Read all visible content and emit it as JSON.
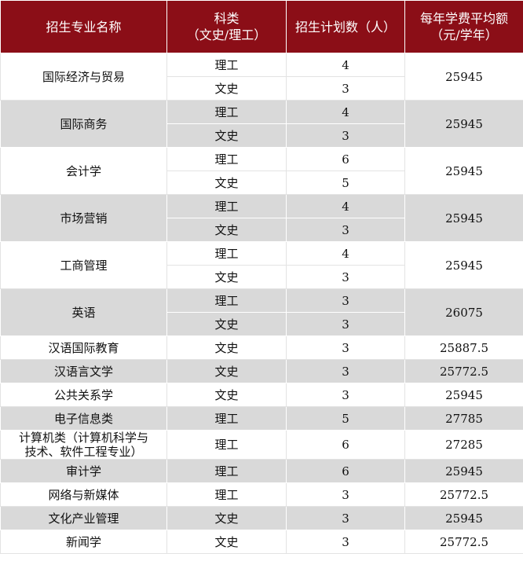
{
  "header": {
    "col_major": "招生专业名称",
    "col_category_line1": "科类",
    "col_category_line2": "（文史/理工）",
    "col_plan": "招生计划数（人）",
    "col_fee_line1": "每年学费平均额",
    "col_fee_line2": "（元/学年）"
  },
  "rows": [
    {
      "major": "国际经济与贸易",
      "fee": "25945",
      "tracks": [
        {
          "category": "理工",
          "count": "4"
        },
        {
          "category": "文史",
          "count": "3"
        }
      ]
    },
    {
      "major": "国际商务",
      "fee": "25945",
      "tracks": [
        {
          "category": "理工",
          "count": "4"
        },
        {
          "category": "文史",
          "count": "3"
        }
      ]
    },
    {
      "major": "会计学",
      "fee": "25945",
      "tracks": [
        {
          "category": "理工",
          "count": "6"
        },
        {
          "category": "文史",
          "count": "5"
        }
      ]
    },
    {
      "major": "市场营销",
      "fee": "25945",
      "tracks": [
        {
          "category": "理工",
          "count": "4"
        },
        {
          "category": "文史",
          "count": "3"
        }
      ]
    },
    {
      "major": "工商管理",
      "fee": "25945",
      "tracks": [
        {
          "category": "理工",
          "count": "4"
        },
        {
          "category": "文史",
          "count": "3"
        }
      ]
    },
    {
      "major": "英语",
      "fee": "26075",
      "tracks": [
        {
          "category": "理工",
          "count": "3"
        },
        {
          "category": "文史",
          "count": "3"
        }
      ]
    },
    {
      "major": "汉语国际教育",
      "fee": "25887.5",
      "tracks": [
        {
          "category": "文史",
          "count": "3"
        }
      ]
    },
    {
      "major": "汉语言文学",
      "fee": "25772.5",
      "tracks": [
        {
          "category": "文史",
          "count": "3"
        }
      ]
    },
    {
      "major": "公共关系学",
      "fee": "25945",
      "tracks": [
        {
          "category": "文史",
          "count": "3"
        }
      ]
    },
    {
      "major": "电子信息类",
      "fee": "27785",
      "tracks": [
        {
          "category": "理工",
          "count": "5"
        }
      ]
    },
    {
      "major_line1": "计算机类（计算机科学与",
      "major_line2": "技术、软件工程专业）",
      "fee": "27285",
      "tracks": [
        {
          "category": "理工",
          "count": "6"
        }
      ]
    },
    {
      "major": "审计学",
      "fee": "25945",
      "tracks": [
        {
          "category": "理工",
          "count": "6"
        }
      ]
    },
    {
      "major": "网络与新媒体",
      "fee": "25772.5",
      "tracks": [
        {
          "category": "理工",
          "count": "3"
        }
      ]
    },
    {
      "major": "文化产业管理",
      "fee": "25945",
      "tracks": [
        {
          "category": "文史",
          "count": "3"
        }
      ]
    },
    {
      "major": "新闻学",
      "fee": "25772.5",
      "tracks": [
        {
          "category": "文史",
          "count": "3"
        }
      ]
    }
  ]
}
